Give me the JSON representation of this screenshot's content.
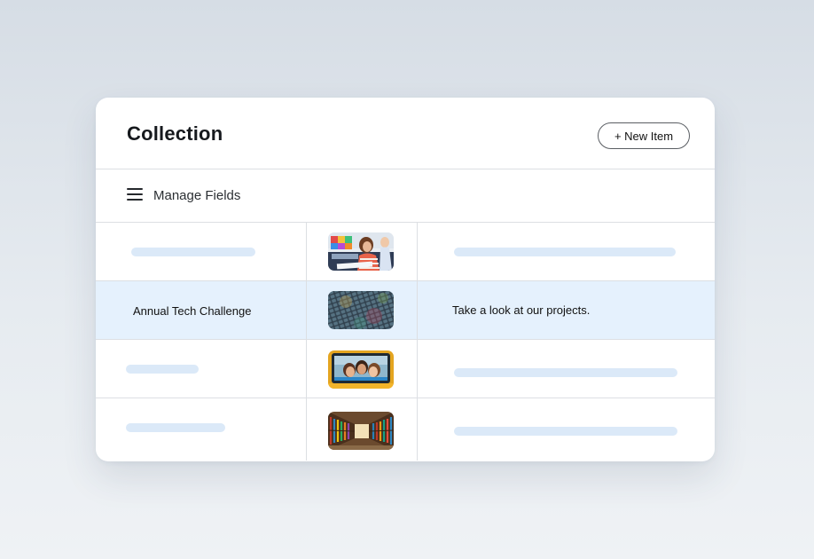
{
  "header": {
    "title": "Collection",
    "new_item_label": "+ New Item"
  },
  "toolbar": {
    "manage_fields_label": "Manage Fields",
    "menu_icon": "hamburger-menu-icon"
  },
  "rows": [
    {
      "title": "",
      "image": "girl-studying-classroom-image",
      "description": ""
    },
    {
      "title": "Annual Tech Challenge",
      "image": "colorful-keyboard-lights-image",
      "description": "Take a look at our projects.",
      "selected": true
    },
    {
      "title": "",
      "image": "kids-on-school-bus-image",
      "description": ""
    },
    {
      "title": "",
      "image": "library-bookshelves-image",
      "description": ""
    }
  ],
  "colors": {
    "selected_row": "#e5f1fd",
    "skeleton": "#dbe9f8"
  }
}
